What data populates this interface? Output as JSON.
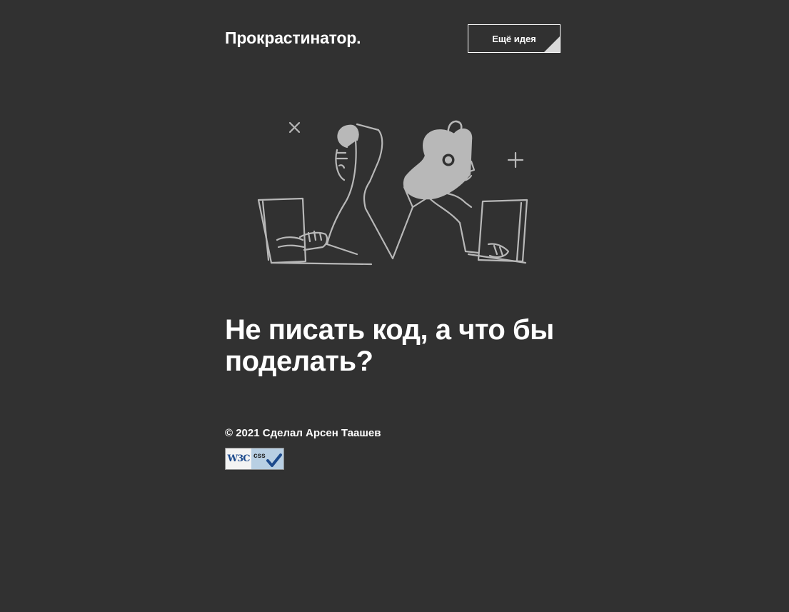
{
  "header": {
    "logo": "Прокрастинатор.",
    "idea_button_label": "Ещё идея"
  },
  "main": {
    "illustration_icon": "two-coders-back-to-back-illustration",
    "headline": "Не писать код, а что бы поделать?"
  },
  "footer": {
    "copyright": "© 2021 Сделал Арсен Таашев",
    "badge": {
      "w3c_text": "W3C",
      "css_text": "css",
      "icon": "w3c-css-valid-badge"
    }
  },
  "colors": {
    "background": "#313131",
    "text": "#ffffff",
    "illustration": "#b8b8b8"
  }
}
